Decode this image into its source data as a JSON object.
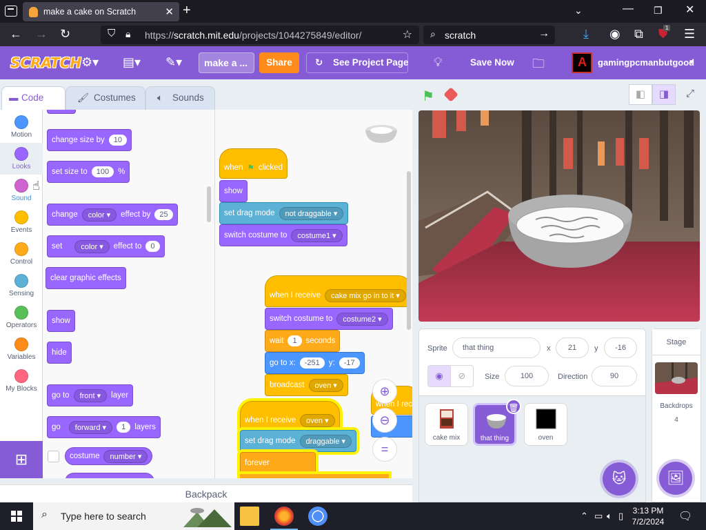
{
  "browser": {
    "tab_title": "make a cake on Scratch",
    "url_prefix": "https://",
    "url_main": "scratch.mit.edu",
    "url_rest": "/projects/1044275849/editor/",
    "search_text": "scratch",
    "extension_badge": "1"
  },
  "menubar": {
    "logo": "SCRATCH",
    "project_title": "make a ...",
    "share": "Share",
    "see_project_page": "See Project Page",
    "save_now": "Save Now",
    "username": "gamingpcmanbutgood"
  },
  "editor_tabs": [
    "Code",
    "Costumes",
    "Sounds"
  ],
  "categories": [
    {
      "label": "Motion",
      "color": "#4c97ff"
    },
    {
      "label": "Looks",
      "color": "#9966ff"
    },
    {
      "label": "Sound",
      "color": "#cf63cf"
    },
    {
      "label": "Events",
      "color": "#ffbf00"
    },
    {
      "label": "Control",
      "color": "#ffab19"
    },
    {
      "label": "Sensing",
      "color": "#5cb1d6"
    },
    {
      "label": "Operators",
      "color": "#59c059"
    },
    {
      "label": "Variables",
      "color": "#ff8c1a"
    },
    {
      "label": "My Blocks",
      "color": "#ff6680"
    }
  ],
  "palette": {
    "change_size_by": "change size by",
    "change_size_val": "10",
    "set_size_to": "set size to",
    "set_size_val": "100",
    "percent": "%",
    "change": "change",
    "color_dd": "color",
    "effect_by": "effect by",
    "effect_by_val": "25",
    "set": "set",
    "effect_to": "effect to",
    "effect_to_val": "0",
    "clear_graphic_effects": "clear graphic effects",
    "show": "show",
    "hide": "hide",
    "go_to": "go to",
    "front_dd": "front",
    "layer": "layer",
    "go": "go",
    "forward_dd": "forward",
    "layers_val": "1",
    "layers": "layers",
    "costume": "costume",
    "number_dd": "number"
  },
  "scripts": {
    "when": "when",
    "clicked": "clicked",
    "show": "show",
    "set_drag_mode": "set drag mode",
    "not_draggable": "not draggable",
    "switch_costume_to": "switch costume to",
    "costume1": "costume1",
    "when_i_receive": "when I receive",
    "cake_msg": "cake mix go in to it",
    "costume2": "costume2",
    "wait": "wait",
    "wait_val": "1",
    "seconds": "seconds",
    "go_to_x": "go to x:",
    "x_val": "-251",
    "y_lbl": "y:",
    "y_val": "-17",
    "broadcast": "broadcast",
    "oven": "oven",
    "when_i_rece_partial": "when I rece",
    "draggable": "draggable",
    "forever": "forever"
  },
  "backpack": "Backpack",
  "sprite_info": {
    "sprite_label": "Sprite",
    "sprite_name": "that thing",
    "x_label": "x",
    "x_value": "21",
    "y_label": "y",
    "y_value": "-16",
    "size_label": "Size",
    "size_value": "100",
    "direction_label": "Direction",
    "direction_value": "90"
  },
  "sprites": [
    {
      "name": "cake mix",
      "selected": false
    },
    {
      "name": "that thing",
      "selected": true
    },
    {
      "name": "oven",
      "selected": false
    }
  ],
  "stage_panel": {
    "title": "Stage",
    "backdrops_label": "Backdrops",
    "backdrops_count": "4"
  },
  "taskbar": {
    "search_placeholder": "Type here to search",
    "time": "3:13 PM",
    "date": "7/2/2024"
  }
}
